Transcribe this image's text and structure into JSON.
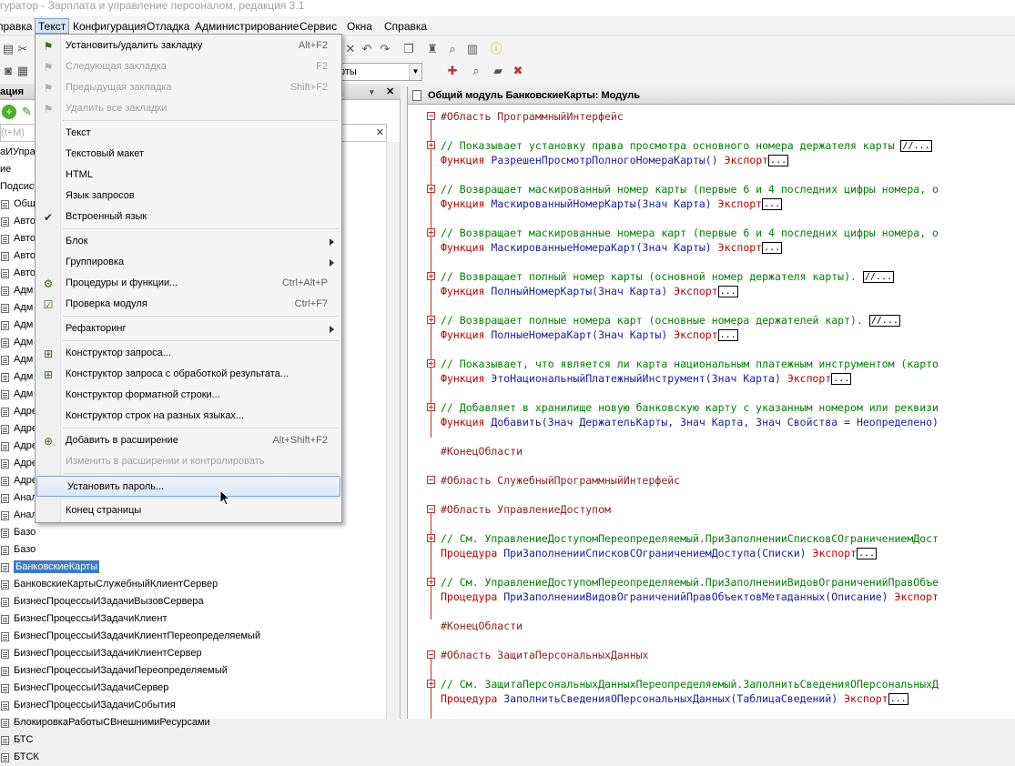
{
  "window": {
    "title": "гуратор - Зарплата и управление персоналом, редакция 3.1"
  },
  "menubar": {
    "items": [
      "правка",
      "Текст",
      "Конфигурация",
      "Отладка",
      "Администрирование",
      "Сервис",
      "Окна",
      "Справка"
    ]
  },
  "toolbar": {
    "combo_value": "рты"
  },
  "left_panel": {
    "title": "ация",
    "search_placeholder": "(t+M)",
    "tree": [
      "аИУпра",
      "ие",
      "Подсист",
      "Общие м",
      "Авто",
      "Авто",
      "Авто",
      "Авто",
      "Адм",
      "Адм",
      "Адм",
      "Адм",
      "Адм",
      "Адм",
      "Адм",
      "Адре",
      "Адре",
      "Адре",
      "Адре",
      "Адре",
      "Анал",
      "Анал",
      "Базо",
      "Базо",
      "БанковскиеКарты",
      "БанковскиеКартыСлужебныйКлиентСервер",
      "БизнесПроцессыИЗадачиВызовСервера",
      "БизнесПроцессыИЗадачиКлиент",
      "БизнесПроцессыИЗадачиКлиентПереопределяемый",
      "БизнесПроцессыИЗадачиКлиентСервер",
      "БизнесПроцессыИЗадачиПереопределяемый",
      "БизнесПроцессыИЗадачиСервер",
      "БизнесПроцессыИЗадачиСобытия",
      "БлокировкаРаботыСВнешнимиРесурсами",
      "БТС",
      "БТСК"
    ],
    "selected_item": "БанковскиеКарты"
  },
  "text_menu": {
    "items": [
      {
        "label": "Установить/удалить закладку",
        "shortcut": "Alt+F2",
        "icon": "bookmark-flag-icon",
        "disabled": false
      },
      {
        "label": "Следующая закладка",
        "shortcut": "F2",
        "icon": "bookmark-next-icon",
        "disabled": true
      },
      {
        "label": "Предыдущая закладка",
        "shortcut": "Shift+F2",
        "icon": "bookmark-prev-icon",
        "disabled": true
      },
      {
        "label": "Удалить все закладки",
        "shortcut": "",
        "icon": "bookmark-clear-icon",
        "disabled": true
      },
      {
        "label": "Текст",
        "shortcut": "",
        "icon": "",
        "disabled": false
      },
      {
        "label": "Текстовый макет",
        "shortcut": "",
        "icon": "",
        "disabled": false
      },
      {
        "label": "HTML",
        "shortcut": "",
        "icon": "",
        "disabled": false
      },
      {
        "label": "Язык запросов",
        "shortcut": "",
        "icon": "",
        "disabled": false
      },
      {
        "label": "Встроенный язык",
        "shortcut": "",
        "icon": "checkmark-icon",
        "disabled": false
      },
      {
        "label": "Блок",
        "shortcut": "",
        "icon": "",
        "disabled": false,
        "submenu": true
      },
      {
        "label": "Группировка",
        "shortcut": "",
        "icon": "",
        "disabled": false,
        "submenu": true
      },
      {
        "label": "Процедуры и функции...",
        "shortcut": "Ctrl+Alt+P",
        "icon": "procedures-icon",
        "disabled": false
      },
      {
        "label": "Проверка модуля",
        "shortcut": "Ctrl+F7",
        "icon": "check-module-icon",
        "disabled": false
      },
      {
        "label": "Рефакторинг",
        "shortcut": "",
        "icon": "",
        "disabled": false,
        "submenu": true
      },
      {
        "label": "Конструктор запроса...",
        "shortcut": "",
        "icon": "query-builder-icon",
        "disabled": false
      },
      {
        "label": "Конструктор запроса с обработкой результата...",
        "shortcut": "",
        "icon": "query-builder-result-icon",
        "disabled": false
      },
      {
        "label": "Конструктор форматной строки...",
        "shortcut": "",
        "icon": "",
        "disabled": false
      },
      {
        "label": "Конструктор строк на разных языках...",
        "shortcut": "",
        "icon": "",
        "disabled": false
      },
      {
        "label": "Добавить в расширение",
        "shortcut": "Alt+Shift+F2",
        "icon": "add-extension-icon",
        "disabled": false
      },
      {
        "label": "Изменить в расширении и контролировать",
        "shortcut": "",
        "icon": "",
        "disabled": true
      },
      {
        "label": "Установить пароль...",
        "shortcut": "",
        "icon": "",
        "disabled": false,
        "hover": true
      },
      {
        "label": "Конец страницы",
        "shortcut": "",
        "icon": "",
        "disabled": false
      }
    ]
  },
  "code_panel": {
    "title": "Общий модуль БанковскиеКарты: Модуль",
    "lines": {
      "l1": "#Область ПрограммныйИнтерфейс",
      "l2_c": "// Показывает установку права просмотра основного номера держателя карты ",
      "l2_e": "//...",
      "l3_k": "Функция ",
      "l3_n": "РазрешенПросмотрПолногоНомераКарты() ",
      "l3_x": "Экспорт",
      "l4_c": "// Возвращает маскированный номер карты (первые 6 и 4 последних цифры номера, о",
      "l5_k": "Функция ",
      "l5_n": "МаскированныйНомерКарты(Знач Карта) ",
      "l5_x": "Экспорт",
      "l6_c": "// Возвращает маскированные номера карт (первые 6 и 4 последних цифры номера, о",
      "l7_k": "Функция ",
      "l7_n": "МаскированныеНомераКарт(Знач Карты) ",
      "l7_x": "Экспорт",
      "l8_c": "// Возвращает полный номер карты (основной номер держателя карты). ",
      "l8_e": "//...",
      "l9_k": "Функция ",
      "l9_n": "ПолныйНомерКарты(Знач Карта) ",
      "l9_x": "Экспорт",
      "l10_c": "// Возвращает полные номера карт (основные номера держателей карт). ",
      "l10_e": "//...",
      "l11_k": "Функция ",
      "l11_n": "ПолныеНомераКарт(Знач Карты) ",
      "l11_x": "Экспорт",
      "l12_c": "// Показывает, что является ли карта национальным платежным инструментом (карто",
      "l13_k": "Функция ",
      "l13_n": "ЭтоНациональныйПлатежныйИнструмент(Знач Карта) ",
      "l13_x": "Экспорт",
      "l14_c": "// Добавляет в хранилище новую банковскую карту с указанным номером или реквизи",
      "l15_k": "Функция ",
      "l15_n": "Добавить(Знач ДержательКарты, Знач Карта, Знач Свойства = Неопределено) ",
      "l16": "#КонецОбласти",
      "l17": "#Область СлужебныйПрограммныйИнтерфейс",
      "l18": "#Область УправлениеДоступом",
      "l19_c": "// См. УправлениеДоступомПереопределяемый.ПриЗаполненииСписковСОграничениемДост",
      "l20_k": "Процедура ",
      "l20_n": "ПриЗаполненииСписковСОграничениемДоступа(Списки) ",
      "l20_x": "Экспорт",
      "l21_c": "// См. УправлениеДоступомПереопределяемый.ПриЗаполненииВидовОграниченийПравОбъе",
      "l22_k": "Процедура ",
      "l22_n": "ПриЗаполненииВидовОграниченийПравОбъектовМетаданных(Описание) ",
      "l22_x": "Экспорт",
      "l23": "#КонецОбласти",
      "l24": "#Область ЗащитаПерсональныхДанных",
      "l25_c": "// См. ЗащитаПерсональныхДанныхПереопределяемый.ЗаполнитьСведенияОПерсональныхД",
      "l26_k": "Процедура ",
      "l26_n": "ЗаполнитьСведенияОПерсональныхДанных(ТаблицаСведений) ",
      "l26_x": "Экспорт",
      "ellipsis": "..."
    }
  }
}
